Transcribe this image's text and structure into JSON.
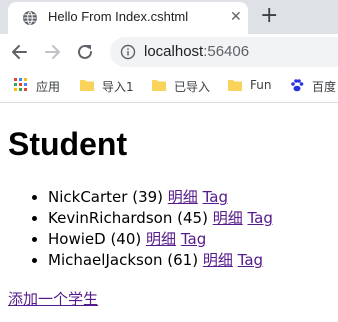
{
  "browser": {
    "tab_title": "Hello From Index.cshtml",
    "url_host": "localhost",
    "url_port": ":56406",
    "bookmarks": [
      {
        "label": "应用",
        "icon": "apps-icon"
      },
      {
        "label": "导入1",
        "icon": "folder-icon"
      },
      {
        "label": "已导入",
        "icon": "folder-icon"
      },
      {
        "label": "Fun",
        "icon": "folder-icon"
      },
      {
        "label": "百度",
        "icon": "baidu-icon"
      }
    ]
  },
  "page": {
    "heading": "Student",
    "students": [
      {
        "name": "NickCarter",
        "age": "(39)",
        "detail": "明细",
        "tag": "Tag"
      },
      {
        "name": "KevinRichardson",
        "age": "(45)",
        "detail": "明细",
        "tag": "Tag"
      },
      {
        "name": "HowieD",
        "age": "(40)",
        "detail": "明细",
        "tag": "Tag"
      },
      {
        "name": "MichaelJackson",
        "age": "(61)",
        "detail": "明细",
        "tag": "Tag"
      }
    ],
    "add_link": "添加一个学生"
  },
  "colors": {
    "link_visited": "#551a8b",
    "tabstrip": "#dee1e6",
    "omnibox": "#f1f3f4"
  }
}
